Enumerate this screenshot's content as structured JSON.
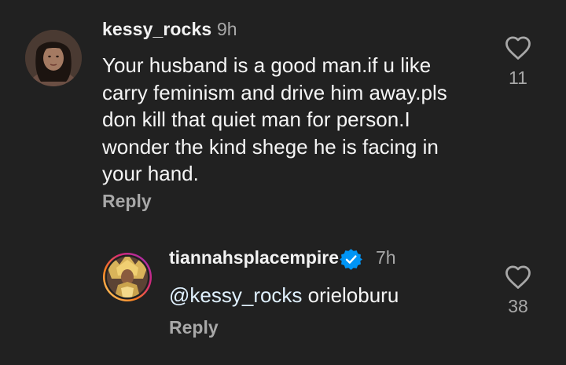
{
  "comments": [
    {
      "username": "kessy_rocks",
      "time": "9h",
      "text_lines": [
        "Your husband is a good man.if u like",
        "carry feminism and drive him away.pls",
        "don kill that quiet man for person.I",
        "wonder the kind shege he is facing in",
        "your hand."
      ],
      "reply_label": "Reply",
      "likes": "11",
      "icon_like": "heart-outline-icon"
    },
    {
      "username": "tiannahsplacempire",
      "verified": true,
      "time": "7h",
      "mention": "@kessy_rocks",
      "text": "orieloburu",
      "reply_label": "Reply",
      "likes": "38",
      "icon_like": "heart-outline-icon",
      "icon_verified": "verified-badge-icon"
    }
  ],
  "colors": {
    "background": "#212121",
    "primary_text": "#f5f5f5",
    "secondary_text": "#a8a8a8",
    "verified_blue": "#0095f6",
    "mention_text": "#e0f1ff"
  }
}
